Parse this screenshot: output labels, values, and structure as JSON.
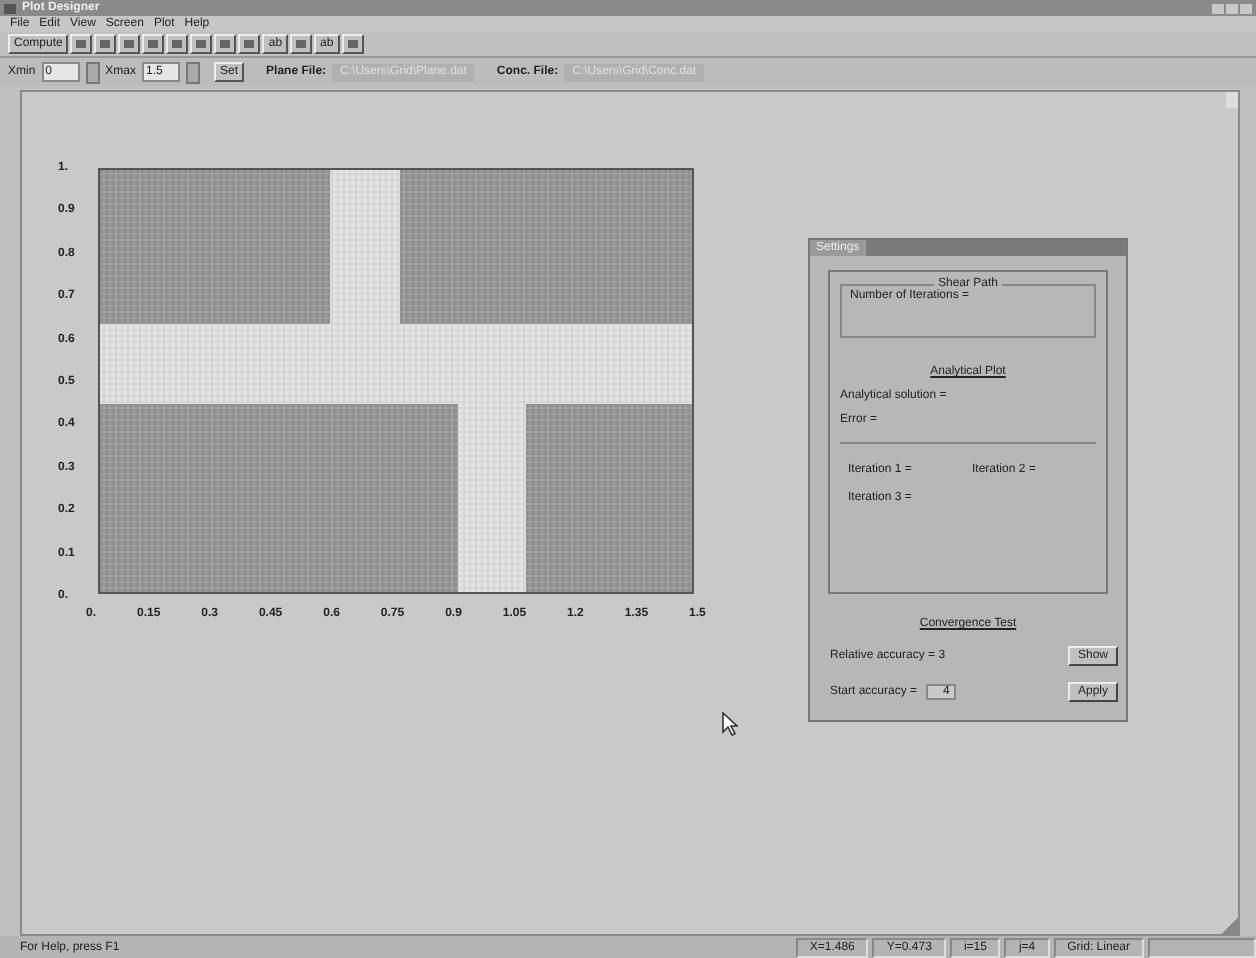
{
  "window": {
    "title": "Plot Designer"
  },
  "menu": [
    "File",
    "Edit",
    "View",
    "Screen",
    "Plot",
    "Help"
  ],
  "toolbar": [
    {
      "kind": "text",
      "label": "Compute"
    },
    {
      "kind": "icon"
    },
    {
      "kind": "icon"
    },
    {
      "kind": "icon"
    },
    {
      "kind": "icon"
    },
    {
      "kind": "icon"
    },
    {
      "kind": "icon"
    },
    {
      "kind": "icon"
    },
    {
      "kind": "icon"
    },
    {
      "kind": "text",
      "label": "ab"
    },
    {
      "kind": "icon"
    },
    {
      "kind": "text",
      "label": "ab"
    },
    {
      "kind": "icon"
    }
  ],
  "range_bar": {
    "xmin_label": "Xmin",
    "xmin": "0",
    "xmax_label": "Xmax",
    "xmax": "1.5",
    "set_button": "Set",
    "plane_label": "Plane File:",
    "plane_file": "C:\\Users\\Grid\\Plane.dat",
    "conc_label": "Conc. File:",
    "conc_file": "C:\\Users\\Grid\\Conc.dat"
  },
  "plot": {
    "yticks": [
      "1.",
      "0.9",
      "0.8",
      "0.7",
      "0.6",
      "0.5",
      "0.4",
      "0.3",
      "0.2",
      "0.1",
      "0."
    ],
    "xticks": [
      "0.",
      "0.15",
      "0.3",
      "0.45",
      "0.6",
      "0.75",
      "0.9",
      "1.05",
      "1.2",
      "1.35",
      "1.5"
    ]
  },
  "dialog": {
    "title": "Settings",
    "shear_group": "Shear Path",
    "iterations_label": "Number of Iterations =",
    "analytical_heading": "Analytical Plot",
    "solution_label": "Analytical solution =",
    "error_label": "Error =",
    "iter_labels": [
      "Iteration 1 =",
      "Iteration 2 =",
      "Iteration 3 ="
    ],
    "convergence_heading": "Convergence Test",
    "relative_label": "Relative accuracy = 3",
    "start_label": "Start accuracy =",
    "start_value": "4",
    "buttons": [
      "Show",
      "Apply"
    ]
  },
  "status_bar": {
    "message": "For Help, press F1",
    "panes": [
      "X=1.486",
      "Y=0.473",
      "i=15",
      "j=4",
      "Grid: Linear"
    ]
  }
}
